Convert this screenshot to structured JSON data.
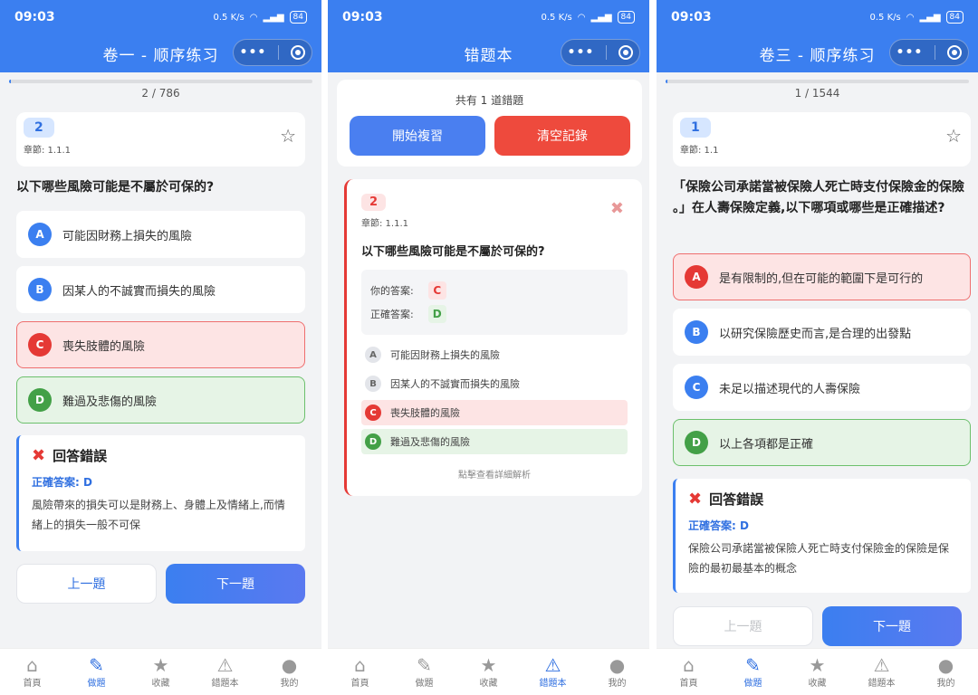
{
  "status": {
    "time": "09:03",
    "net": "0.5 K/s",
    "battery": "84"
  },
  "tabbar": [
    {
      "label": "首頁",
      "icon": "home-icon"
    },
    {
      "label": "做題",
      "icon": "pencil-icon"
    },
    {
      "label": "收藏",
      "icon": "star-icon"
    },
    {
      "label": "錯題本",
      "icon": "warning-icon"
    },
    {
      "label": "我的",
      "icon": "user-icon"
    }
  ],
  "screen1": {
    "title": "卷一 - 顺序练习",
    "counter": "2 / 786",
    "progress_fraction": 0.003,
    "qnum": "2",
    "chapter": "章節: 1.1.1",
    "question": "以下哪些風險可能是不屬於可保的?",
    "options": [
      {
        "letter": "A",
        "text": "可能因財務上損失的風險",
        "state": "normal"
      },
      {
        "letter": "B",
        "text": "因某人的不誠實而損失的風險",
        "state": "normal"
      },
      {
        "letter": "C",
        "text": "喪失肢體的風險",
        "state": "wrong"
      },
      {
        "letter": "D",
        "text": "難過及悲傷的風險",
        "state": "right"
      }
    ],
    "feedback_title": "回答錯誤",
    "feedback_answer": "正確答案: D",
    "feedback_text": "風險帶來的損失可以是財務上、身體上及情緒上,而情緒上的損失一般不可保",
    "prev": "上一題",
    "next": "下一題",
    "active_tab": 1
  },
  "screen2": {
    "title": "错题本",
    "summary": "共有 1 道錯題",
    "start": "開始複習",
    "clear": "清空記錄",
    "qnum": "2",
    "chapter": "章節: 1.1.1",
    "question": "以下哪些風險可能是不屬於可保的?",
    "your_answer_label": "你的答案:",
    "your_answer": "C",
    "correct_answer_label": "正確答案:",
    "correct_answer": "D",
    "options": [
      {
        "letter": "A",
        "text": "可能因財務上損失的風險",
        "state": "normal"
      },
      {
        "letter": "B",
        "text": "因某人的不誠實而損失的風險",
        "state": "normal"
      },
      {
        "letter": "C",
        "text": "喪失肢體的風險",
        "state": "wrong"
      },
      {
        "letter": "D",
        "text": "難過及悲傷的風險",
        "state": "right"
      }
    ],
    "hint": "點擊查看詳細解析",
    "active_tab": 3
  },
  "screen3": {
    "title": "卷三 - 顺序练习",
    "counter": "1 / 1544",
    "progress_fraction": 0.0006,
    "qnum": "1",
    "chapter": "章節: 1.1",
    "question": "「保險公司承諾當被保險人死亡時支付保險金的保險 。」在人壽保險定義,以下哪項或哪些是正確描述?",
    "options": [
      {
        "letter": "A",
        "text": "是有限制的,但在可能的範圍下是可行的",
        "state": "wrong"
      },
      {
        "letter": "B",
        "text": "以研究保險歷史而言,是合理的出發點",
        "state": "normal"
      },
      {
        "letter": "C",
        "text": "未足以描述現代的人壽保險",
        "state": "normal"
      },
      {
        "letter": "D",
        "text": "以上各項都是正確",
        "state": "right"
      }
    ],
    "feedback_title": "回答錯誤",
    "feedback_answer": "正確答案: D",
    "feedback_text": "保險公司承諾當被保險人死亡時支付保險金的保險是保險的最初最基本的概念",
    "prev": "上一題",
    "next": "下一題",
    "active_tab": 1
  }
}
